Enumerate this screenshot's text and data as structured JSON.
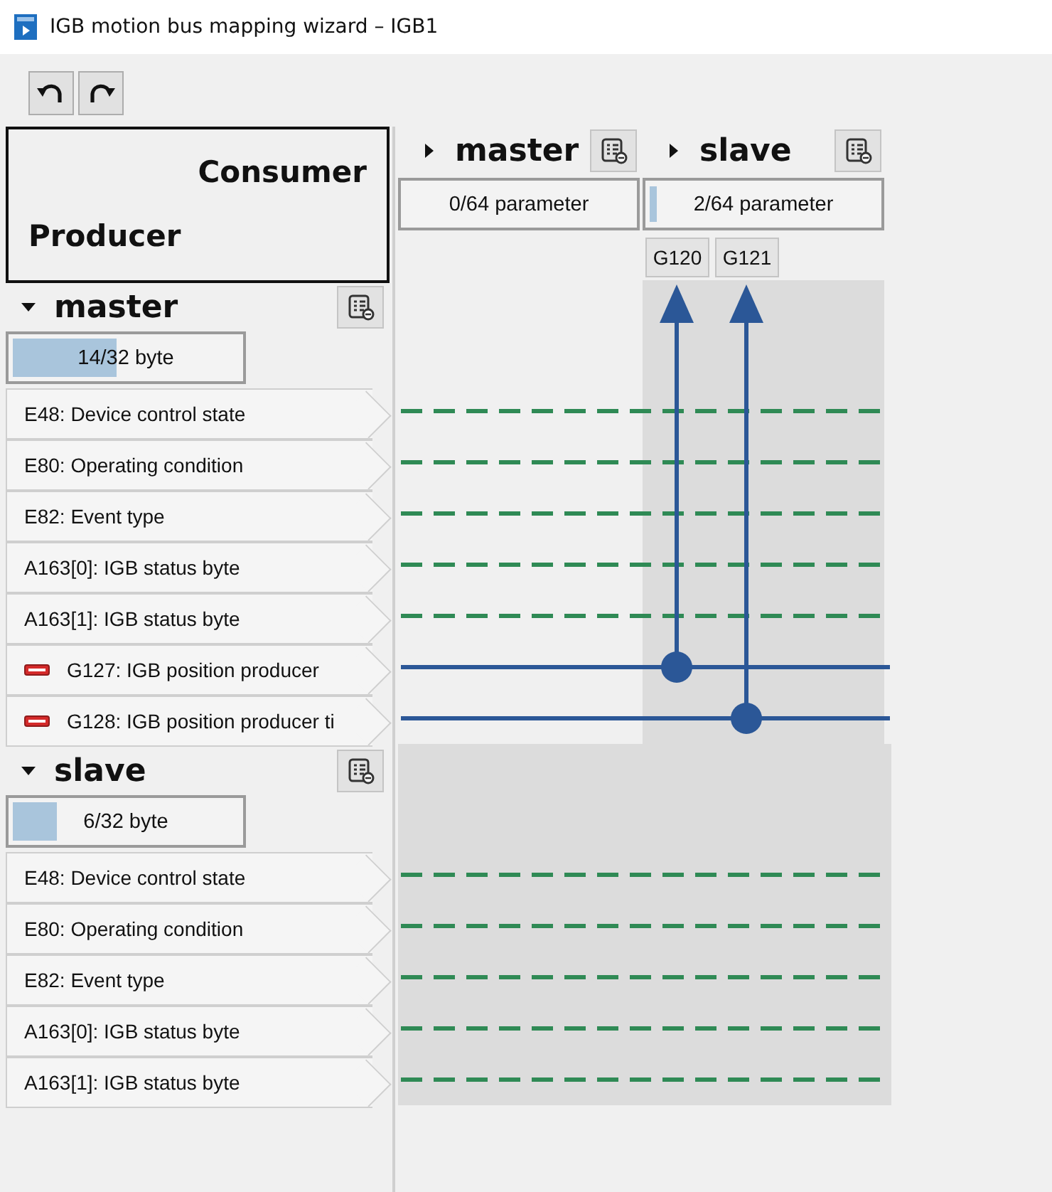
{
  "window": {
    "title": "IGB motion bus mapping wizard – IGB1"
  },
  "toolbar": [
    {
      "kind": "undo"
    },
    {
      "kind": "redo"
    }
  ],
  "corner": {
    "consumer_label": "Consumer",
    "producer_label": "Producer"
  },
  "consumers": [
    {
      "name": "master",
      "expanded": false,
      "usage": "0/64 parameter"
    },
    {
      "name": "slave",
      "expanded": false,
      "usage": "2/64 parameter",
      "level": 0.03,
      "parameters": [
        "G120",
        "G121"
      ]
    }
  ],
  "producers": [
    {
      "name": "master",
      "expanded": true,
      "usage": "14/32 byte",
      "level": 0.44,
      "rows": [
        {
          "label": "E48: Device control state",
          "mapped": false
        },
        {
          "label": "E80: Operating condition",
          "mapped": false
        },
        {
          "label": "E82: Event type",
          "mapped": false
        },
        {
          "label": "A163[0]: IGB status byte",
          "mapped": false
        },
        {
          "label": "A163[1]: IGB status byte",
          "mapped": false
        },
        {
          "label": "G127: IGB position producer",
          "mapped": true
        },
        {
          "label": "G128: IGB position producer ti",
          "mapped": true
        }
      ]
    },
    {
      "name": "slave",
      "expanded": true,
      "usage": "6/32 byte",
      "level": 0.19,
      "rows": [
        {
          "label": "E48: Device control state",
          "mapped": false
        },
        {
          "label": "E80: Operating condition",
          "mapped": false
        },
        {
          "label": "E82: Event type",
          "mapped": false
        },
        {
          "label": "A163[0]: IGB status byte",
          "mapped": false
        },
        {
          "label": "A163[1]: IGB status byte",
          "mapped": false
        }
      ]
    }
  ]
}
